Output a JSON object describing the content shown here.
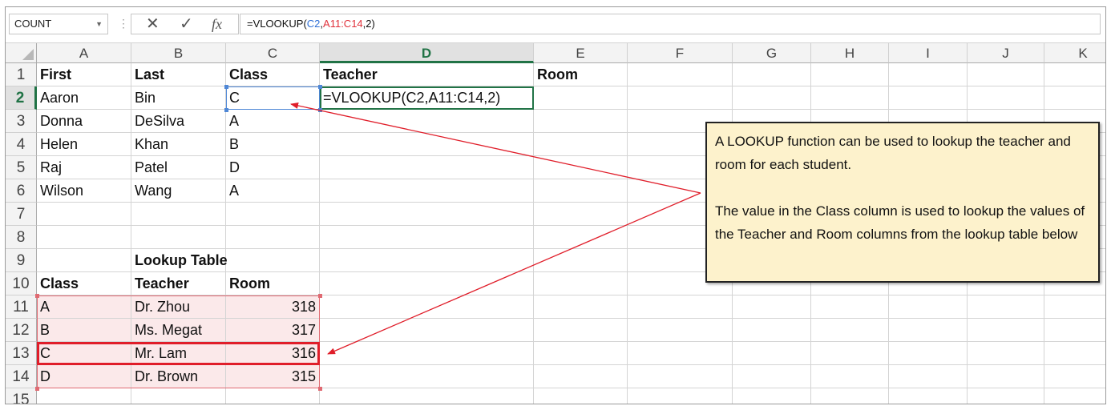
{
  "name_box": {
    "value": "COUNT"
  },
  "formula_bar": {
    "cancel_icon": "✕",
    "enter_icon": "✓",
    "fx_icon": "fx",
    "formula": {
      "prefix": "=VLOOKUP(",
      "ref1": "C2",
      "sep1": ",",
      "ref2": "A11:C14",
      "suffix": ",2)"
    }
  },
  "columns": [
    "A",
    "B",
    "C",
    "D",
    "E",
    "F",
    "G",
    "H",
    "I",
    "J",
    "K"
  ],
  "selected_column": "D",
  "rows": [
    "1",
    "2",
    "3",
    "4",
    "5",
    "6",
    "7",
    "8",
    "9",
    "10",
    "11",
    "12",
    "13",
    "14",
    "15"
  ],
  "selected_row": "2",
  "cells": {
    "A1": "First",
    "B1": "Last",
    "C1": "Class",
    "D1": "Teacher",
    "E1": "Room",
    "A2": "Aaron",
    "B2": "Bin",
    "C2": "C",
    "D2": "=VLOOKUP(C2,A11:C14,2)",
    "A3": "Donna",
    "B3": "DeSilva",
    "C3": "A",
    "A4": "Helen",
    "B4": "Khan",
    "C4": "B",
    "A5": "Raj",
    "B5": "Patel",
    "C5": "D",
    "A6": "Wilson",
    "B6": "Wang",
    "C6": "A",
    "B9": "Lookup Table",
    "A10": "Class",
    "B10": "Teacher",
    "C10": "Room",
    "A11": "A",
    "B11": "Dr. Zhou",
    "C11": "318",
    "A12": "B",
    "B12": "Ms. Megat",
    "C12": "317",
    "A13": "C",
    "B13": "Mr. Lam",
    "C13": "316",
    "A14": "D",
    "B14": "Dr. Brown",
    "C14": "315"
  },
  "callout": {
    "para1": "A LOOKUP function can be used to lookup the teacher and room for each student.",
    "para2": "The value in the Class column is used to lookup the values of the Teacher and Room columns from the lookup table below"
  },
  "colors": {
    "excel_green": "#217346",
    "arrow_red": "#e01e2a",
    "ref_blue": "#2e6fd6",
    "callout_fill": "#fdf2cc"
  }
}
